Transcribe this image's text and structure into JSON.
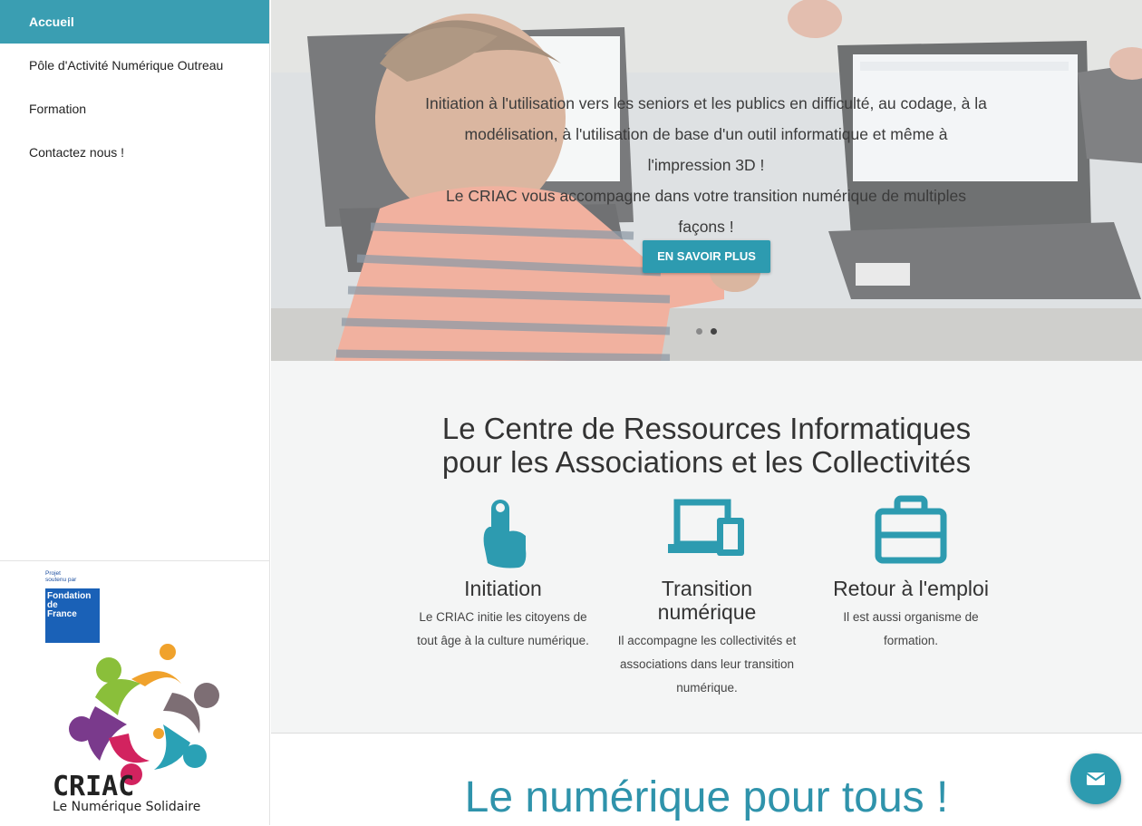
{
  "sidebar": {
    "items": [
      {
        "label": "Accueil",
        "active": true
      },
      {
        "label": "Pôle d'Activité Numérique Outreau",
        "active": false
      },
      {
        "label": "Formation",
        "active": false
      },
      {
        "label": "Contactez nous !",
        "active": false
      }
    ],
    "sponsor": {
      "caption_line1": "Projet",
      "caption_line2": "soutenu par",
      "logo_line1": "Fondation",
      "logo_line2": "de",
      "logo_line3": "France"
    },
    "logo": {
      "name": "CRIAC",
      "tagline": "Le Numérique Solidaire"
    }
  },
  "hero": {
    "text_line1": "Initiation à l'utilisation vers les seniors et les publics en difficulté, au codage, à la modélisation, à l'utilisation de base d'un outil informatique et même à l'impression 3D !",
    "text_line2": "Le CRIAC vous accompagne dans votre transition numérique de multiples façons !",
    "button_label": "EN SAVOIR PLUS",
    "slides_count": 2,
    "active_slide": 2
  },
  "features": {
    "title_line1": "Le Centre de Ressources Informatiques",
    "title_line2": "pour les Associations et les Collectivités",
    "items": [
      {
        "icon": "touch-hand-icon",
        "title": "Initiation",
        "text": "Le CRIAC initie les citoyens de tout âge à la culture numérique."
      },
      {
        "icon": "devices-icon",
        "title": "Transition numérique",
        "text": "Il accompagne les collectivités et associations dans leur transition numérique."
      },
      {
        "icon": "briefcase-icon",
        "title": "Retour à l'emploi",
        "text": "Il est aussi organisme de formation."
      }
    ]
  },
  "bottom": {
    "title": "Le numérique pour tous !"
  },
  "colors": {
    "accent": "#2d9bb0",
    "sidebar_active": "#3a9eb2",
    "title_blue": "#2f93ab"
  },
  "chat": {
    "icon": "mail-icon"
  }
}
